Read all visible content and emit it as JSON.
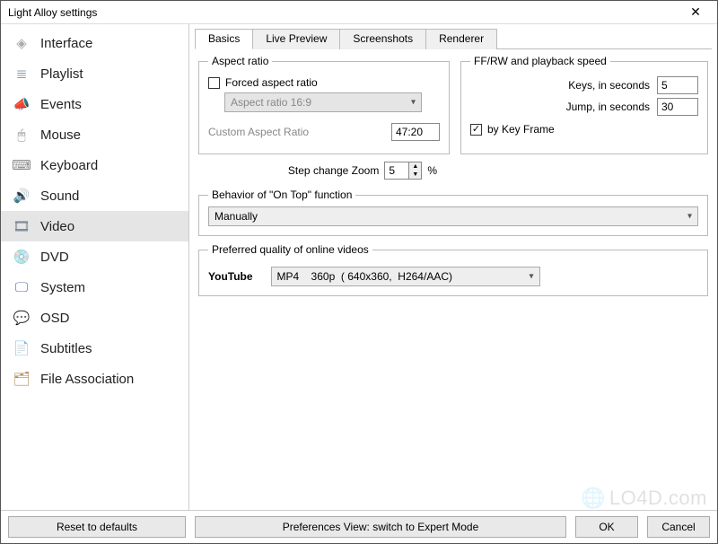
{
  "window": {
    "title": "Light Alloy settings"
  },
  "sidebar": {
    "items": [
      {
        "label": "Interface",
        "icon": "◈"
      },
      {
        "label": "Playlist",
        "icon": "≣"
      },
      {
        "label": "Events",
        "icon": "📣"
      },
      {
        "label": "Mouse",
        "icon": "🖱"
      },
      {
        "label": "Keyboard",
        "icon": "⌨"
      },
      {
        "label": "Sound",
        "icon": "🔊"
      },
      {
        "label": "Video",
        "icon": "🎞"
      },
      {
        "label": "DVD",
        "icon": "💿"
      },
      {
        "label": "System",
        "icon": "🖵"
      },
      {
        "label": "OSD",
        "icon": "💬"
      },
      {
        "label": "Subtitles",
        "icon": "📄"
      },
      {
        "label": "File Association",
        "icon": "🗂"
      }
    ],
    "selected": "Video"
  },
  "tabs": {
    "items": [
      "Basics",
      "Live Preview",
      "Screenshots",
      "Renderer"
    ],
    "active": "Basics"
  },
  "aspect": {
    "legend": "Aspect ratio",
    "forced_label": "Forced aspect ratio",
    "forced_checked": false,
    "ratio_select": "Aspect ratio 16:9",
    "custom_label": "Custom Aspect Ratio",
    "custom_value": "47:20"
  },
  "step_zoom": {
    "label": "Step change Zoom",
    "value": "5",
    "suffix": "%"
  },
  "ffrw": {
    "legend": "FF/RW and playback speed",
    "keys_label": "Keys, in seconds",
    "keys_value": "5",
    "jump_label": "Jump, in seconds",
    "jump_value": "30",
    "keyframe_label": "by Key Frame",
    "keyframe_checked": true
  },
  "ontop": {
    "legend": "Behavior of \"On Top\" function",
    "value": "Manually"
  },
  "quality": {
    "legend": "Preferred quality of online videos",
    "provider": "YouTube",
    "value": "MP4    360p  ( 640x360,  H264/AAC)"
  },
  "footer": {
    "reset": "Reset to defaults",
    "pref": "Preferences View: switch to Expert Mode",
    "ok": "OK",
    "cancel": "Cancel"
  },
  "watermark": "LO4D.com"
}
